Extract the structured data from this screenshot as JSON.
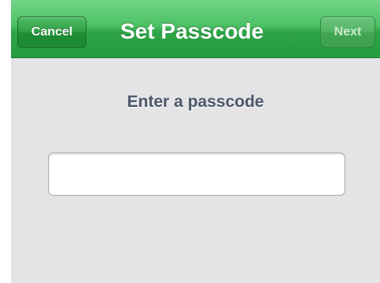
{
  "navbar": {
    "title": "Set Passcode",
    "cancel_label": "Cancel",
    "next_label": "Next",
    "next_enabled": false,
    "accent_color": "#2fa547"
  },
  "main": {
    "prompt": "Enter a passcode",
    "passcode_value": "",
    "passcode_placeholder": ""
  }
}
